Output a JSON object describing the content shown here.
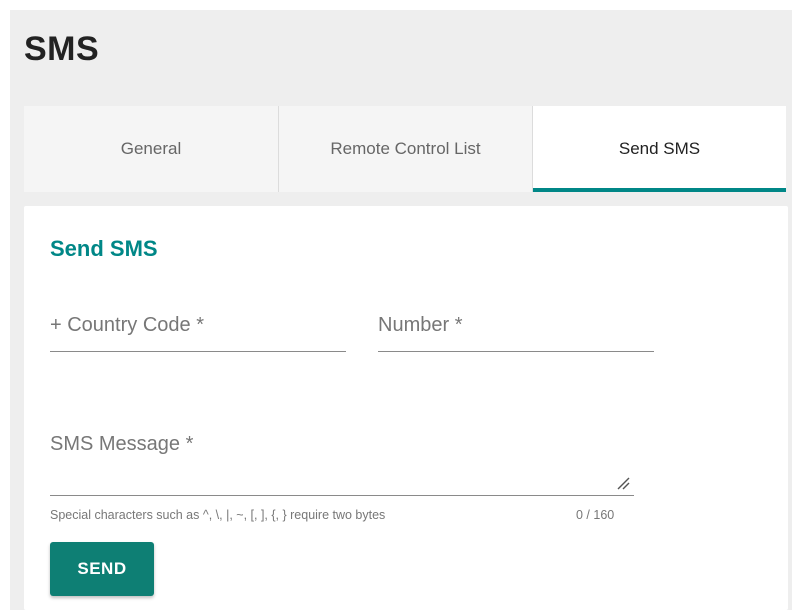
{
  "page": {
    "title": "SMS"
  },
  "tabs": [
    {
      "label": "General",
      "active": false
    },
    {
      "label": "Remote Control List",
      "active": false
    },
    {
      "label": "Send SMS",
      "active": true
    }
  ],
  "form": {
    "section_title": "Send SMS",
    "country_code": {
      "value": "",
      "placeholder": "+ Country Code *"
    },
    "number": {
      "value": "",
      "placeholder": "Number *"
    },
    "message": {
      "value": "",
      "placeholder": "SMS Message *",
      "hint": "Special characters such as ^, \\, |, ~, [, ], {, } require two bytes",
      "counter": "0 / 160"
    },
    "send_label": "SEND"
  },
  "colors": {
    "accent": "#008787",
    "button": "#0e7f74",
    "panel_background": "#eeeeee"
  },
  "icons": {
    "textarea_resize": "resize-handle-icon"
  }
}
